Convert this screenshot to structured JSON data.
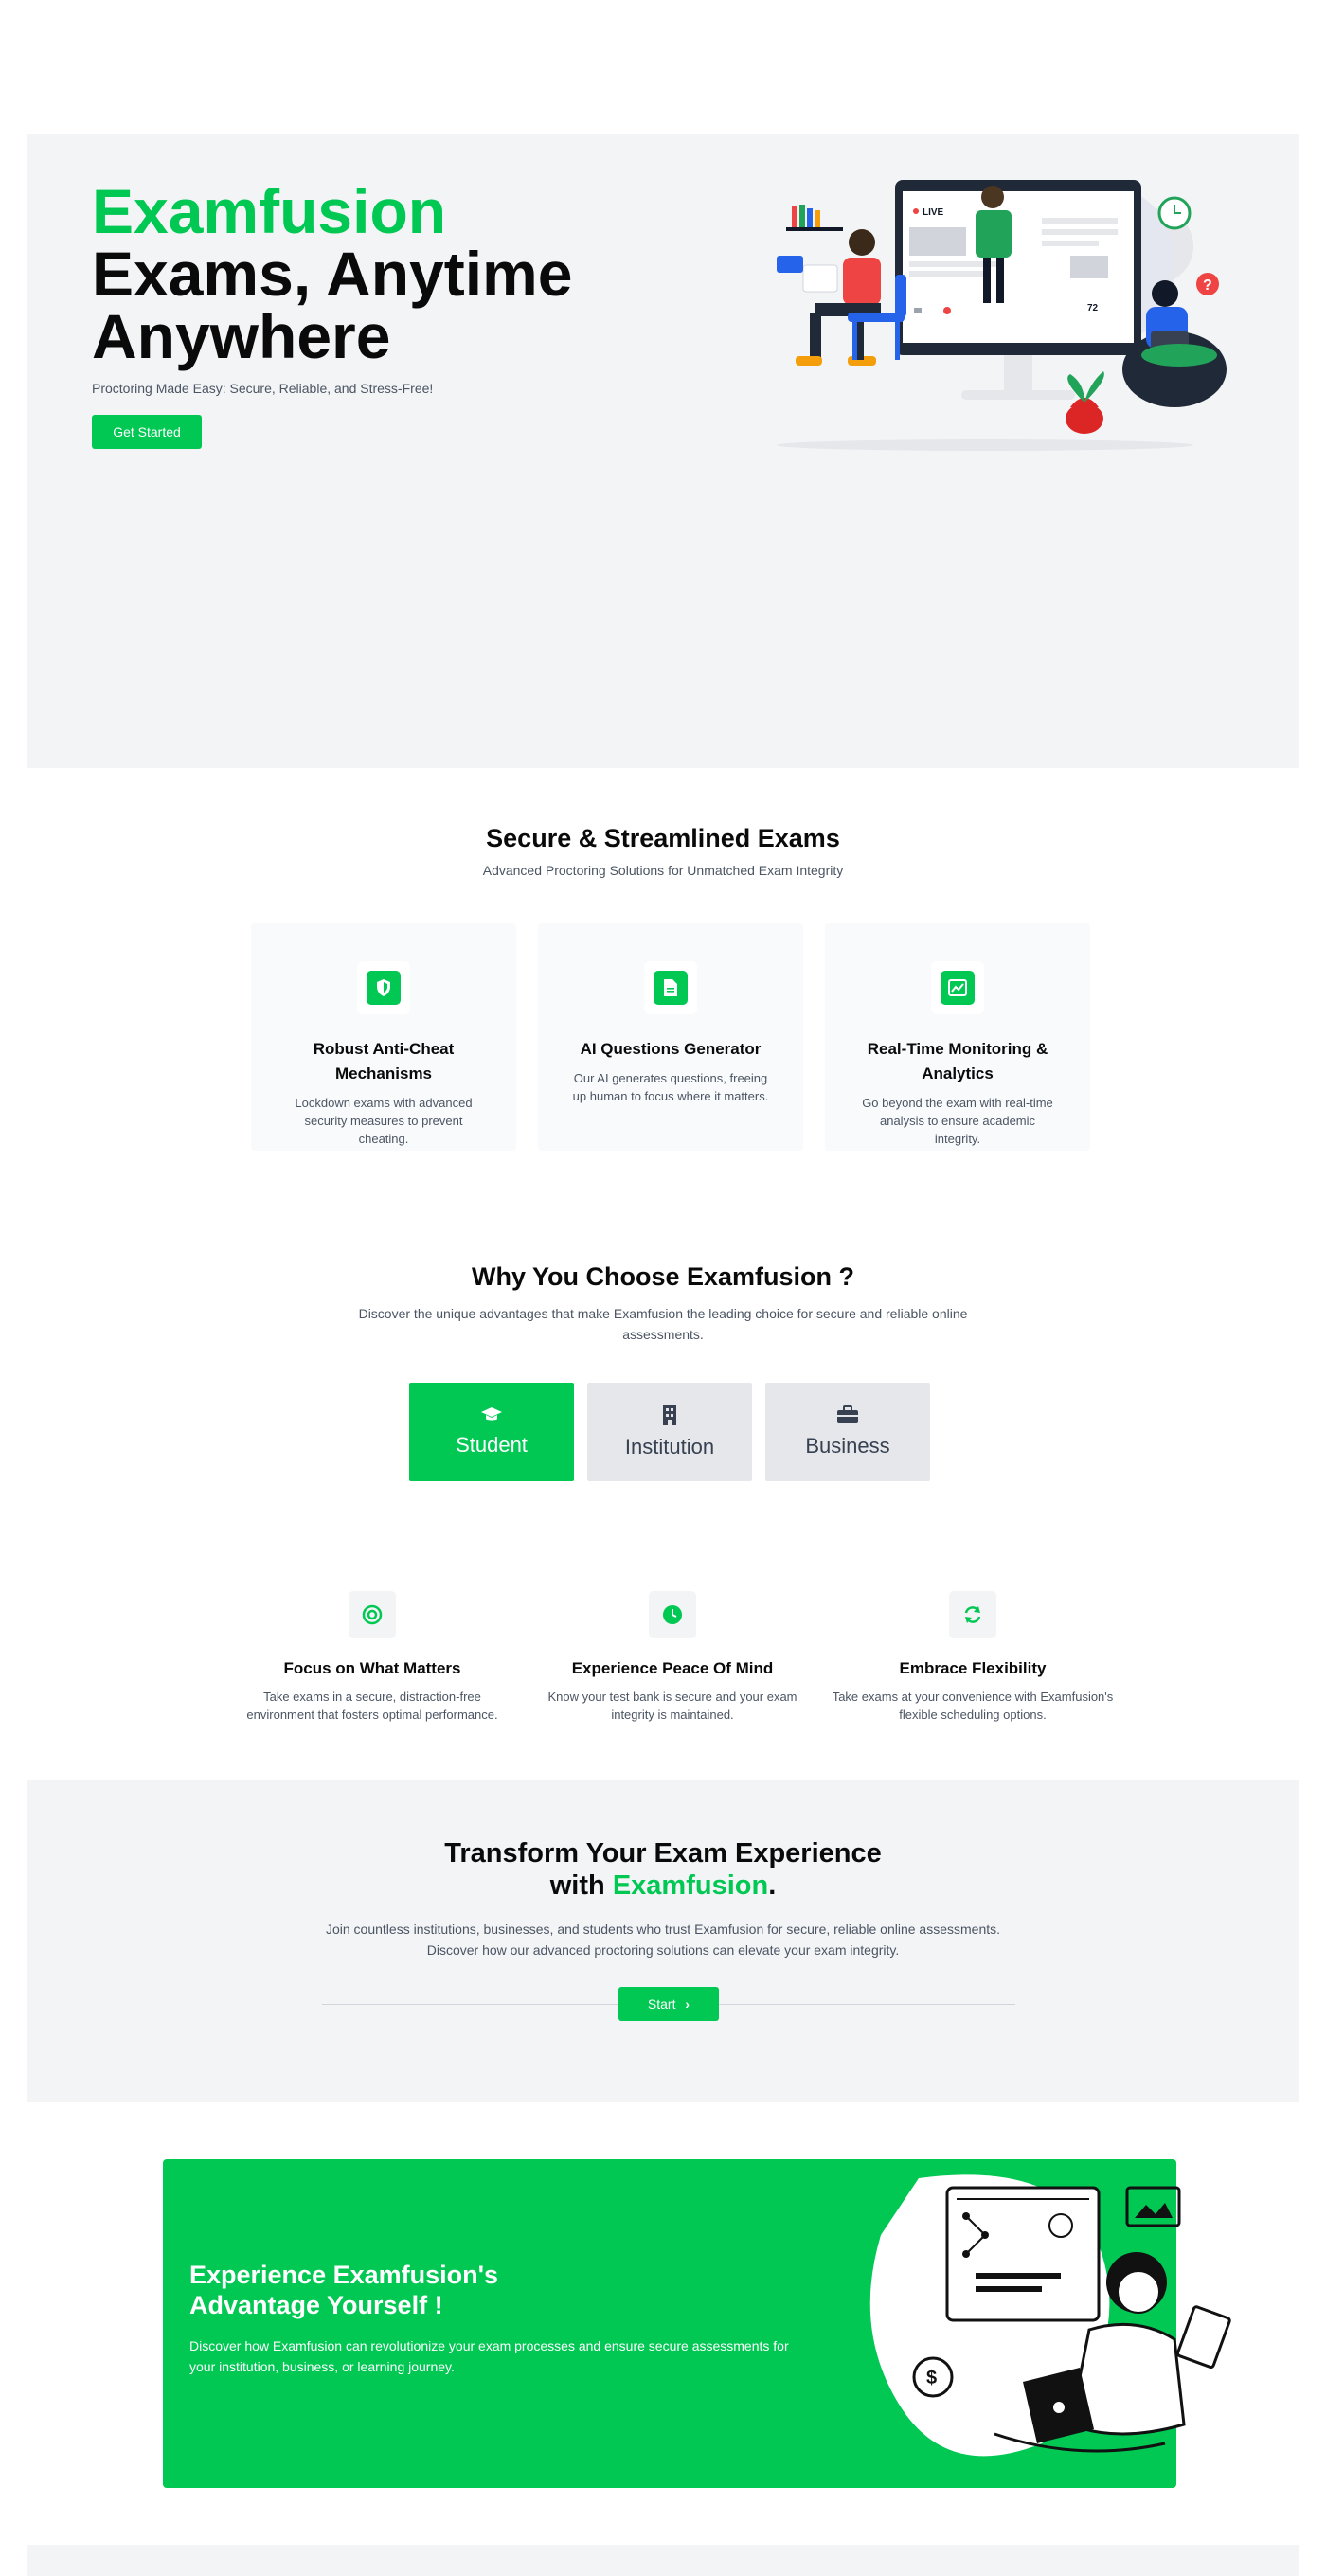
{
  "hero": {
    "brand": "Examfusion",
    "title": "Exams, Anytime Anywhere",
    "subtitle": "Proctoring Made Easy: Secure, Reliable, and Stress-Free!",
    "cta_label": "Get Started",
    "live_badge": "LIVE",
    "viewer_count": "72"
  },
  "secure": {
    "title": "Secure & Streamlined Exams",
    "subtitle": "Advanced Proctoring Solutions for Unmatched Exam Integrity",
    "cards": [
      {
        "title": "Robust Anti-Cheat Mechanisms",
        "desc": "Lockdown exams with advanced security measures to prevent cheating.",
        "icon": "shield-icon"
      },
      {
        "title": "AI Questions Generator",
        "desc": "Our AI generates questions, freeing up human to focus where it matters.",
        "icon": "document-icon"
      },
      {
        "title": "Real-Time Monitoring & Analytics",
        "desc": "Go beyond the exam with real-time analysis to ensure academic integrity.",
        "icon": "chart-icon"
      }
    ]
  },
  "why": {
    "title": "Why You Choose Examfusion ?",
    "subtitle": "Discover the unique advantages that make Examfusion the leading choice for secure and reliable online assessments.",
    "tabs": [
      {
        "label": "Student",
        "icon": "graduation-cap-icon",
        "active": true
      },
      {
        "label": "Institution",
        "icon": "building-icon",
        "active": false
      },
      {
        "label": "Business",
        "icon": "briefcase-icon",
        "active": false
      }
    ],
    "features": [
      {
        "title": "Focus on What Matters",
        "desc": "Take exams in a secure, distraction-free environment that fosters optimal performance.",
        "icon": "target-icon"
      },
      {
        "title": "Experience Peace Of Mind",
        "desc": "Know your test bank is secure and your exam integrity is maintained.",
        "icon": "clock-icon"
      },
      {
        "title": "Embrace Flexibility",
        "desc": "Take exams at your convenience with Examfusion's flexible scheduling options.",
        "icon": "refresh-icon"
      }
    ]
  },
  "transform": {
    "title_line1": "Transform Your Exam Experience",
    "title_with": "with",
    "title_brand": "Examfusion",
    "title_end": ".",
    "desc_line1": "Join countless institutions, businesses, and students who trust Examfusion for secure, reliable online assessments.",
    "desc_line2": "Discover how our advanced proctoring solutions can elevate your exam integrity.",
    "button_label": "Start"
  },
  "cta": {
    "title": "Experience Examfusion's Advantage Yourself !",
    "desc": "Discover how Examfusion can revolutionize your exam processes and ensure secure assessments for your institution, business, or learning journey."
  },
  "colors": {
    "accent": "#00c853",
    "hero_bg": "#f3f4f6",
    "text_dark": "#0a0a0a",
    "text_muted": "#4b5563"
  }
}
